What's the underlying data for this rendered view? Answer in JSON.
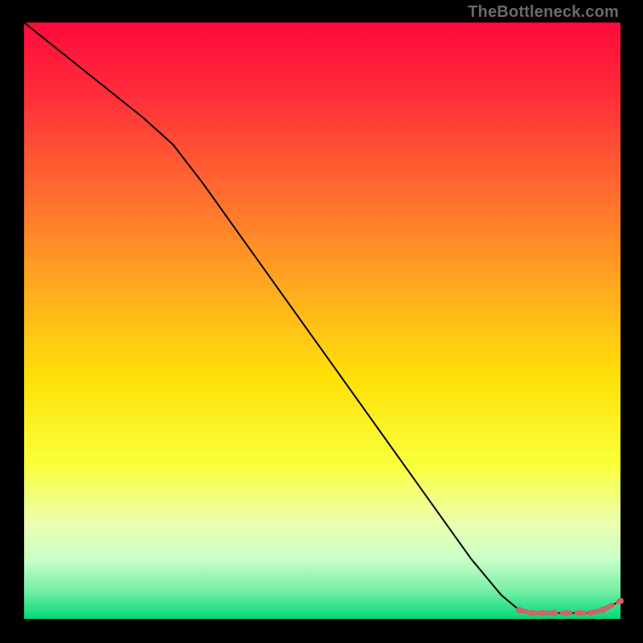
{
  "attribution": "TheBottleneck.com",
  "chart_data": {
    "type": "line",
    "title": "",
    "xlabel": "",
    "ylabel": "",
    "xlim": [
      0,
      100
    ],
    "ylim": [
      0,
      100
    ],
    "x": [
      0,
      5,
      10,
      15,
      20,
      25,
      30,
      35,
      40,
      45,
      50,
      55,
      60,
      65,
      70,
      75,
      80,
      83,
      85,
      87,
      89,
      91,
      93,
      95,
      97,
      100
    ],
    "values": [
      100,
      96,
      92,
      88,
      84,
      79.5,
      73,
      66,
      59,
      52,
      45,
      38,
      31,
      24,
      17,
      10,
      4,
      1.5,
      1,
      1,
      1,
      1,
      1,
      1,
      1.5,
      3
    ],
    "gradient_stops": [
      {
        "offset": 0.0,
        "color": "#ff0a3c"
      },
      {
        "offset": 0.12,
        "color": "#ff2d3a"
      },
      {
        "offset": 0.28,
        "color": "#ff6a2f"
      },
      {
        "offset": 0.44,
        "color": "#ffa81f"
      },
      {
        "offset": 0.6,
        "color": "#ffe20a"
      },
      {
        "offset": 0.74,
        "color": "#f9ff3a"
      },
      {
        "offset": 0.84,
        "color": "#ecffb0"
      },
      {
        "offset": 0.9,
        "color": "#c8ffc8"
      },
      {
        "offset": 0.95,
        "color": "#7af0a8"
      },
      {
        "offset": 1.0,
        "color": "#00d978"
      }
    ],
    "dash_marker_indices": [
      17,
      18,
      19,
      20,
      21,
      22,
      23,
      24,
      25
    ],
    "dash_color": "#cc6666",
    "line_color": "#000000"
  }
}
